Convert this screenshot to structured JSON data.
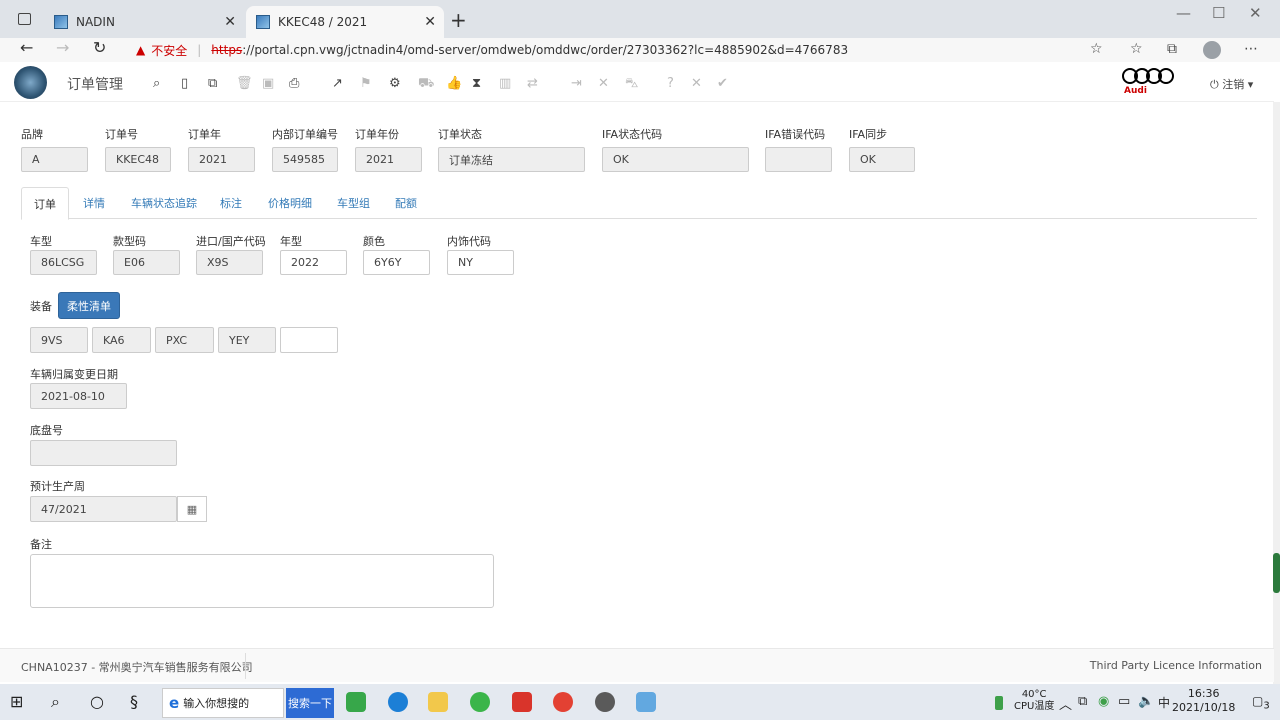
{
  "browser": {
    "tabs": [
      {
        "title": "NADIN"
      },
      {
        "title": "KKEC48 / 2021"
      }
    ],
    "address": {
      "warning": "不安全",
      "scheme": "https",
      "rest": "://portal.cpn.vwg/jctnadin4/omd-server/omdweb/omddwc/order/27303362?lc=4885902&d=4766783"
    }
  },
  "app": {
    "title": "订单管理",
    "logout": "注销",
    "brand": "Audi"
  },
  "header": {
    "fields": [
      {
        "label": "品牌",
        "value": "A"
      },
      {
        "label": "订单号",
        "value": "KKEC48"
      },
      {
        "label": "订单年",
        "value": "2021"
      },
      {
        "label": "内部订单编号",
        "value": "549585"
      },
      {
        "label": "订单年份",
        "value": "2021"
      },
      {
        "label": "订单状态",
        "value": "订单冻结"
      },
      {
        "label": "IFA状态代码",
        "value": "OK"
      },
      {
        "label": "IFA错误代码",
        "value": ""
      },
      {
        "label": "IFA同步",
        "value": "OK"
      }
    ]
  },
  "tabs": [
    "订单",
    "详情",
    "车辆状态追踪",
    "标注",
    "价格明细",
    "车型组",
    "配额"
  ],
  "order": {
    "fields": [
      {
        "label": "车型",
        "value": "86LCSG"
      },
      {
        "label": "款型码",
        "value": "E06"
      },
      {
        "label": "进口/国产代码",
        "value": "X9S"
      },
      {
        "label": "年型",
        "value": "2022"
      },
      {
        "label": "颜色",
        "value": "6Y6Y"
      },
      {
        "label": "内饰代码",
        "value": "NY"
      }
    ],
    "equipment_label": "装备",
    "flex_button": "柔性清单",
    "equipment": [
      "9VS",
      "KA6",
      "PXC",
      "YEY",
      ""
    ],
    "ownership_change_label": "车辆归属变更日期",
    "ownership_change_value": "2021-08-10",
    "chassis_label": "底盘号",
    "chassis_value": "",
    "production_week_label": "预计生产周",
    "production_week_value": "47/2021",
    "remarks_label": "备注"
  },
  "footer": {
    "dealer": "CHNA10237 - 常州奥宁汽车销售服务有限公司",
    "licence": "Third Party Licence Information"
  },
  "taskbar": {
    "search_placeholder": "输入你想搜的",
    "search_button": "搜索一下",
    "temp": "40°C",
    "temp_label": "CPU温度",
    "ime": "中",
    "time": "16:36",
    "date": "2021/10/18",
    "notif_count": "3"
  }
}
